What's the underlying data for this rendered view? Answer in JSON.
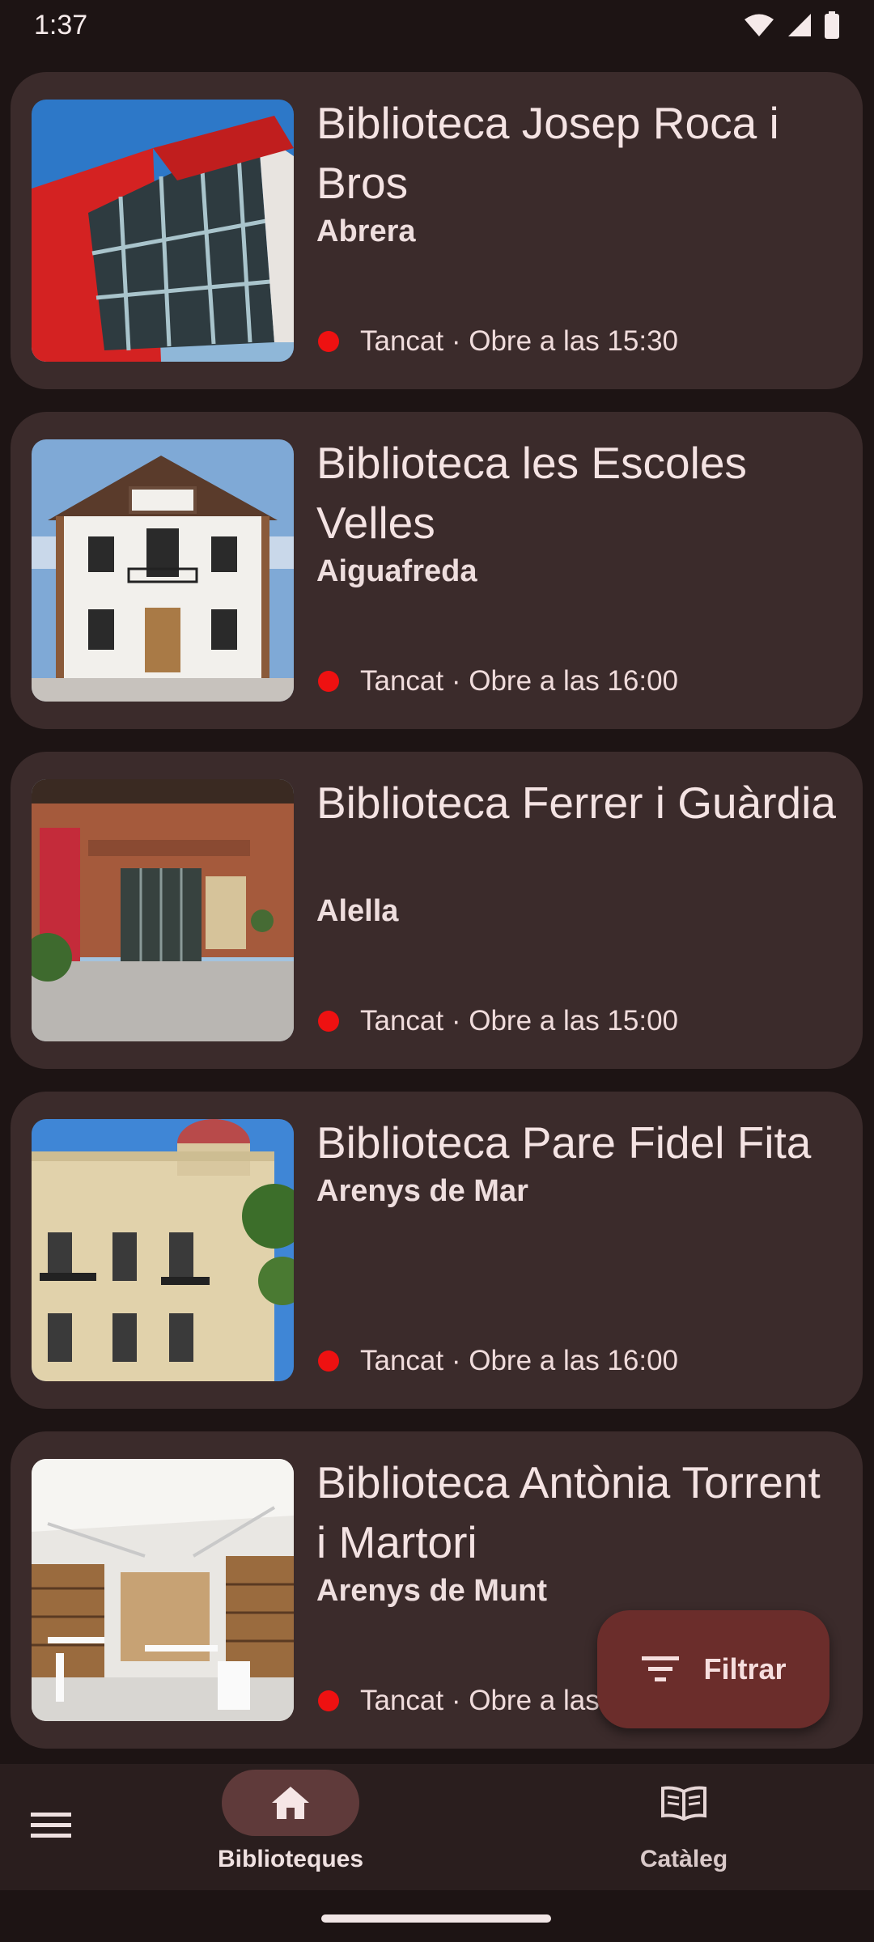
{
  "status_bar": {
    "time": "1:37"
  },
  "libraries": [
    {
      "name": "Biblioteca Josep Roca i Bros",
      "city": "Abrera",
      "status": "Tancat · Obre a las 15:30"
    },
    {
      "name": "Biblioteca les Escoles Velles",
      "city": "Aiguafreda",
      "status": "Tancat · Obre a las 16:00"
    },
    {
      "name": "Biblioteca Ferrer i Guàrdia",
      "city": "Alella",
      "status": "Tancat · Obre a las 15:00"
    },
    {
      "name": "Biblioteca Pare Fidel Fita",
      "city": "Arenys de Mar",
      "status": "Tancat · Obre a las 16:00"
    },
    {
      "name": "Biblioteca Antònia Torrent i Martori",
      "city": "Arenys de Munt",
      "status": "Tancat · Obre a las 16:00"
    }
  ],
  "fab": {
    "label": "Filtrar",
    "icon": "filter-icon"
  },
  "bottom_nav": {
    "menu_icon": "menu-icon",
    "items": [
      {
        "label": "Biblioteques",
        "icon": "home-icon",
        "selected": true
      },
      {
        "label": "Catàleg",
        "icon": "book-icon",
        "selected": false
      }
    ]
  },
  "colors": {
    "closed_dot": "#ee1111",
    "card_bg": "#3b2b2b",
    "fab_bg": "#6b2d2b"
  }
}
